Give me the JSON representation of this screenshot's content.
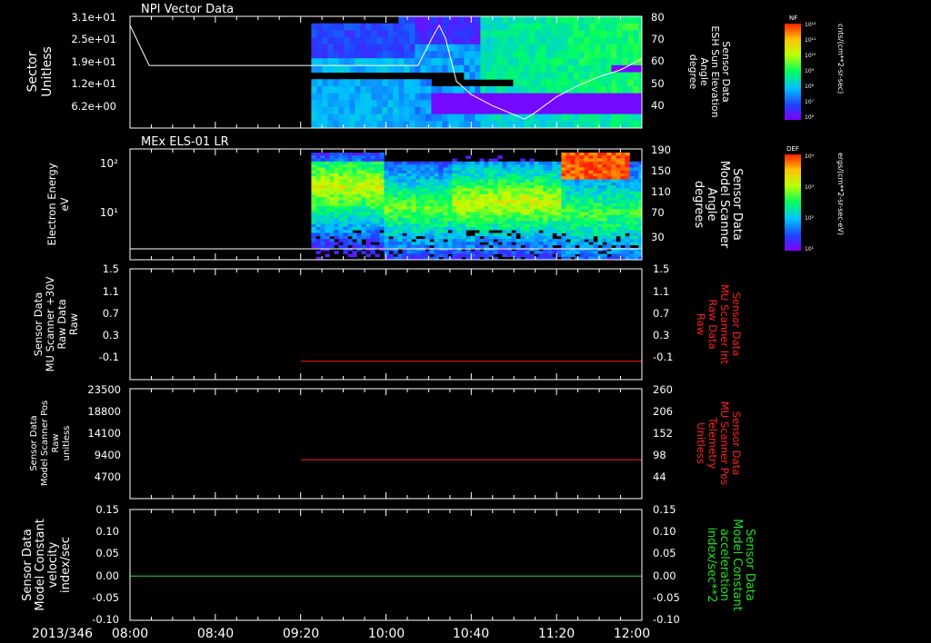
{
  "chart_data": [
    {
      "type": "heatmap",
      "title": "NPI Vector Data",
      "ylabel_left": [
        "Sector",
        "Unitless"
      ],
      "yticks_left": [
        "3.1e+01",
        "2.5e+01",
        "1.9e+01",
        "1.2e+01",
        "6.2e+00"
      ],
      "ylabel_right": [
        "Sensor Data",
        "ESH Sun Elevation",
        "Angle",
        "degree"
      ],
      "yticks_right": [
        "80",
        "70",
        "60",
        "50",
        "40"
      ],
      "ylim_right": [
        30,
        80
      ],
      "line_series": {
        "name": "ESH Sun Elevation Angle",
        "x": [
          "08:00",
          "08:05",
          "08:09",
          "08:20",
          "08:40",
          "09:00",
          "09:20",
          "09:40",
          "10:00",
          "10:15",
          "10:22",
          "10:25",
          "10:28",
          "10:33",
          "10:40",
          "10:50",
          "11:00",
          "11:05",
          "11:10",
          "11:20",
          "11:30",
          "11:40",
          "11:50",
          "12:00"
        ],
        "y": [
          76,
          66,
          58,
          58,
          58,
          58,
          58,
          58,
          58,
          58,
          71,
          76,
          70,
          51,
          45,
          40,
          36,
          34,
          37,
          44,
          49,
          53,
          56,
          61
        ]
      },
      "data_start": "09:25",
      "colorbar": {
        "label": "cnts/(cm**2-sr-sec)",
        "tag": "NF",
        "ticks": [
          "10¹²",
          "10¹¹",
          "10¹⁰",
          "10⁹",
          "10⁸",
          "10⁷",
          "10⁶"
        ]
      }
    },
    {
      "type": "heatmap",
      "title": "MEx ELS-01 LR",
      "ylabel_left": [
        "Electron Energy",
        "eV"
      ],
      "yticks_left": [
        "10²",
        "10¹"
      ],
      "ylabel_right": [
        "Sensor Data",
        "Model Scanner",
        "Angle",
        "degrees"
      ],
      "yticks_right": [
        "190",
        "150",
        "110",
        "70",
        "30"
      ],
      "ylim_right": [
        10,
        190
      ],
      "data_start": "09:25",
      "colorbar": {
        "label": "ergs/(cm**2-sr-sec-eV)",
        "tag": "DEF",
        "ticks": [
          "10⁴",
          "10³",
          "10²",
          "10¹"
        ]
      }
    },
    {
      "type": "line",
      "ylabel_left": [
        "Sensor Data",
        "MU Scanner +30V",
        "Raw Data",
        "Raw"
      ],
      "yticks_left": [
        "1.5",
        "1.1",
        "0.7",
        "0.3",
        "-0.1"
      ],
      "ylim": [
        -0.3,
        1.5
      ],
      "ylabel_right": [
        "Sensor Data",
        "MU Scanner Int",
        "Raw Data",
        "Raw"
      ],
      "yticks_right": [
        "1.5",
        "1.1",
        "0.7",
        "0.3",
        "-0.1"
      ],
      "series": [
        {
          "color": "#ff2020",
          "x": [
            "09:20",
            "12:00"
          ],
          "y": [
            0.0,
            0.0
          ]
        }
      ]
    },
    {
      "type": "line",
      "ylabel_left": [
        "Sensor Data",
        "Model Scanner Pos",
        "Raw",
        "unitless"
      ],
      "yticks_left": [
        "23500",
        "18800",
        "14100",
        "9400",
        "4700"
      ],
      "ylim": [
        0,
        23500
      ],
      "ylabel_right": [
        "Sensor Data",
        "MU Scanner Pos",
        "Telemetry",
        "Unitless"
      ],
      "yticks_right": [
        "260",
        "206",
        "152",
        "98",
        "44"
      ],
      "series": [
        {
          "color": "#ff2020",
          "x": [
            "09:20",
            "12:00"
          ],
          "y": [
            8300,
            8300
          ]
        }
      ]
    },
    {
      "type": "line",
      "ylabel_left": [
        "Sensor Data",
        "Model Constant",
        "velocity",
        "index/sec"
      ],
      "yticks_left": [
        "0.15",
        "0.10",
        "0.05",
        "0.00",
        "-0.05",
        "-0.10"
      ],
      "ylim": [
        -0.1,
        0.15
      ],
      "ylabel_right": [
        "Sensor Data",
        "Model Constant",
        "acceleration",
        "index/sec**2"
      ],
      "yticks_right": [
        "0.15",
        "0.10",
        "0.05",
        "0.00",
        "-0.05",
        "-0.10"
      ],
      "series": [
        {
          "color": "#20e020",
          "x": [
            "08:00",
            "12:00"
          ],
          "y": [
            0.0,
            0.0
          ]
        }
      ]
    }
  ],
  "xaxis": {
    "date_label": "2013/346",
    "ticks": [
      "08:00",
      "08:40",
      "09:20",
      "10:00",
      "10:40",
      "11:20",
      "12:00"
    ]
  },
  "colors": {
    "axis": "#ffffff",
    "background": "#000000",
    "red_label": "#ff2020",
    "green_label": "#20e020"
  }
}
